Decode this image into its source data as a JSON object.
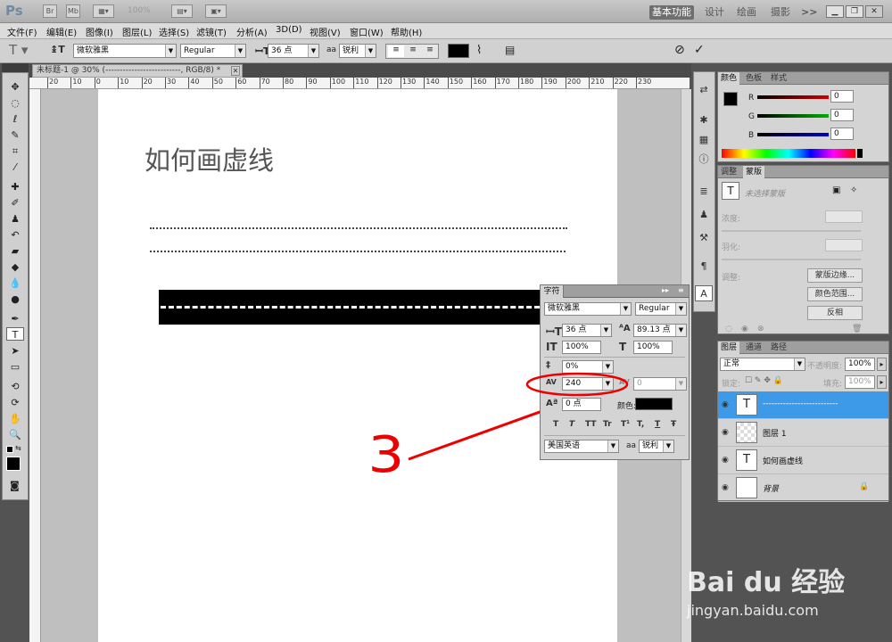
{
  "app": {
    "logo": "Ps",
    "zoom": "100%",
    "workspaces": [
      "基本功能",
      "设计",
      "绘画",
      "摄影",
      ">>"
    ]
  },
  "menu": [
    "文件(F)",
    "编辑(E)",
    "图像(I)",
    "图层(L)",
    "选择(S)",
    "滤镜(T)",
    "分析(A)",
    "3D(D)",
    "视图(V)",
    "窗口(W)",
    "帮助(H)"
  ],
  "options": {
    "font_family": "微软雅黑",
    "font_style": "Regular",
    "font_size": "36 点",
    "aa_label": "aa",
    "antialias": "锐利"
  },
  "document": {
    "tab_title": "未标题-1 @ 30% (--------------------------, RGB/8) *",
    "heading": "如何画虚线",
    "ruler_ticks": [
      "20",
      "10",
      "0",
      "10",
      "20",
      "30",
      "40",
      "50",
      "60",
      "70",
      "80",
      "90",
      "100",
      "110",
      "120",
      "130",
      "140",
      "150",
      "160",
      "170",
      "180",
      "190",
      "200",
      "210",
      "220",
      "230"
    ]
  },
  "annotation": {
    "number": "3"
  },
  "character_panel": {
    "tab": "字符",
    "font_family": "微软雅黑",
    "font_style": "Regular",
    "size": "36 点",
    "leading": "89.13 点",
    "vertical_scale": "100%",
    "horizontal_scale": "100%",
    "tsume": "0%",
    "tracking": "240",
    "kerning": "0",
    "baseline": "0 点",
    "color_label": "颜色:",
    "language": "美国英语",
    "aa_label": "aa",
    "antialias": "锐利",
    "style_buttons": [
      "T",
      "T",
      "TT",
      "Tr",
      "T¹",
      "T,",
      "T",
      "Ŧ"
    ],
    "text_color": "#000000"
  },
  "color_panel": {
    "tabs": [
      "颜色",
      "色板",
      "样式"
    ],
    "channels": [
      {
        "label": "R",
        "value": "0",
        "color": "#d00000"
      },
      {
        "label": "G",
        "value": "0",
        "color": "#00b000"
      },
      {
        "label": "B",
        "value": "0",
        "color": "#0000c0"
      }
    ]
  },
  "masks_panel": {
    "tabs": [
      "调整",
      "蒙版"
    ],
    "no_selection": "未选择蒙版",
    "density": "浓度:",
    "feather": "羽化:",
    "refine": "调整:",
    "buttons": [
      "蒙版边缘...",
      "颜色范围...",
      "反相"
    ]
  },
  "layers_panel": {
    "tabs": [
      "图层",
      "通道",
      "路径"
    ],
    "blend_mode": "正常",
    "opacity_label": "不透明度:",
    "opacity": "100%",
    "lock_label": "锁定:",
    "fill_label": "填充:",
    "fill": "100%",
    "layers": [
      {
        "name": "--------------------------",
        "type": "text",
        "selected": true
      },
      {
        "name": "图层 1",
        "type": "pixel",
        "selected": false
      },
      {
        "name": "如何画虚线",
        "type": "text",
        "selected": false
      },
      {
        "name": "背景",
        "type": "background",
        "selected": false
      }
    ]
  },
  "watermark": {
    "brand": "Bai du 经验",
    "url": "jingyan.baidu.com"
  }
}
